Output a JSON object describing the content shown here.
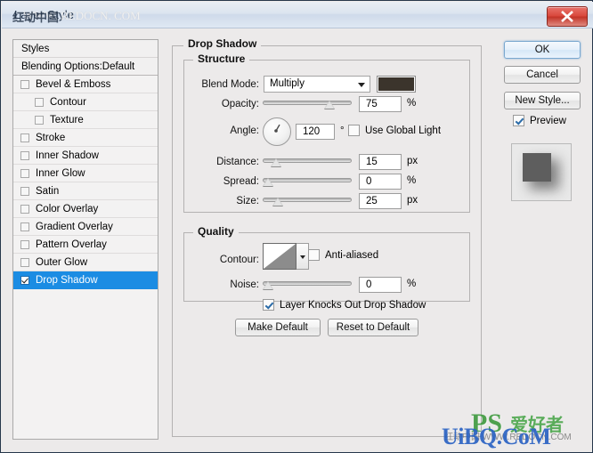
{
  "window": {
    "title": "Layer Style",
    "watermark_title": "WWW. REDOCN. COM",
    "watermark_title_cn": "红动中国",
    "close_label": "close-button"
  },
  "styles_panel": {
    "header": "Styles",
    "blending_options": "Blending Options:Default",
    "effects": [
      {
        "label": "Bevel & Emboss",
        "checked": false,
        "indent": false,
        "selected": false
      },
      {
        "label": "Contour",
        "checked": false,
        "indent": true,
        "selected": false
      },
      {
        "label": "Texture",
        "checked": false,
        "indent": true,
        "selected": false
      },
      {
        "label": "Stroke",
        "checked": false,
        "indent": false,
        "selected": false
      },
      {
        "label": "Inner Shadow",
        "checked": false,
        "indent": false,
        "selected": false
      },
      {
        "label": "Inner Glow",
        "checked": false,
        "indent": false,
        "selected": false
      },
      {
        "label": "Satin",
        "checked": false,
        "indent": false,
        "selected": false
      },
      {
        "label": "Color Overlay",
        "checked": false,
        "indent": false,
        "selected": false
      },
      {
        "label": "Gradient Overlay",
        "checked": false,
        "indent": false,
        "selected": false
      },
      {
        "label": "Pattern Overlay",
        "checked": false,
        "indent": false,
        "selected": false
      },
      {
        "label": "Outer Glow",
        "checked": false,
        "indent": false,
        "selected": false
      },
      {
        "label": "Drop Shadow",
        "checked": true,
        "indent": false,
        "selected": true
      }
    ],
    "selection_color": "#1b8ce3"
  },
  "drop_shadow": {
    "group_title": "Drop Shadow",
    "structure": {
      "title": "Structure",
      "blend_mode_label": "Blend Mode:",
      "blend_mode_value": "Multiply",
      "shadow_color": "#3b342c",
      "opacity_label": "Opacity:",
      "opacity_value": "75",
      "opacity_unit": "%",
      "opacity_pct": 75,
      "angle_label": "Angle:",
      "angle_value": "120",
      "angle_unit": "°",
      "use_global_light": "Use Global Light",
      "use_global_light_checked": false,
      "distance_label": "Distance:",
      "distance_value": "15",
      "distance_unit": "px",
      "distance_pct": 15,
      "spread_label": "Spread:",
      "spread_value": "0",
      "spread_unit": "%",
      "spread_pct": 0,
      "size_label": "Size:",
      "size_value": "25",
      "size_unit": "px",
      "size_pct": 17
    },
    "quality": {
      "title": "Quality",
      "contour_label": "Contour:",
      "anti_aliased_label": "Anti-aliased",
      "anti_aliased_checked": false,
      "noise_label": "Noise:",
      "noise_value": "0",
      "noise_unit": "%",
      "noise_pct": 0
    },
    "knockout_label": "Layer Knocks Out Drop Shadow",
    "knockout_checked": true,
    "make_default": "Make Default",
    "reset_to_default": "Reset to Default"
  },
  "actions": {
    "ok": "OK",
    "cancel": "Cancel",
    "new_style": "New Style...",
    "preview_label": "Preview",
    "preview_checked": true
  },
  "footer_watermarks": {
    "ps_logo": "PS",
    "ps_cn": "爱好者",
    "uibq": "UiBQ.CoM",
    "small_cn": "红动中国  WWW.REDOCN.COM"
  }
}
